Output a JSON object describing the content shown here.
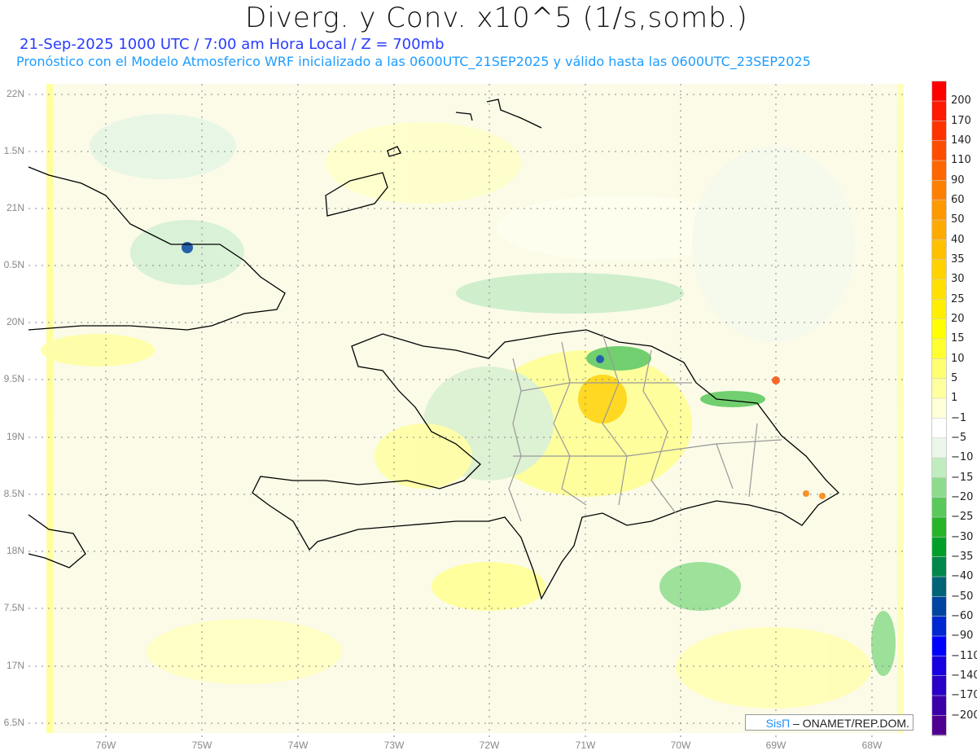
{
  "header": {
    "title": "Diverg. y Conv. x10^5 (1/s,somb.)",
    "valid_line": "21-Sep-2025  1000 UTC / 7:00 am Hora Local / Z = 700mb",
    "model_line": "Pronóstico con el Modelo Atmosferico WRF inicializado a las 0600UTC_21SEP2025 y válido hasta las  0600UTC_23SEP2025"
  },
  "map": {
    "lat_labels": [
      "22N",
      "1.5N",
      "21N",
      "0.5N",
      "20N",
      "9.5N",
      "19N",
      "8.5N",
      "18N",
      "7.5N",
      "17N",
      "6.5N"
    ],
    "lon_labels": [
      "76W",
      "75W",
      "74W",
      "73W",
      "72W",
      "71W",
      "70W",
      "69W",
      "68W"
    ]
  },
  "colorbar": {
    "labels": [
      "200",
      "170",
      "140",
      "110",
      "90",
      "60",
      "50",
      "40",
      "35",
      "30",
      "25",
      "20",
      "15",
      "10",
      "5",
      "1",
      "−1",
      "−5",
      "−10",
      "−15",
      "−20",
      "−25",
      "−30",
      "−35",
      "−40",
      "−50",
      "−60",
      "−90",
      "−110",
      "−140",
      "−170",
      "−200"
    ],
    "colors": [
      "#ff0000",
      "#ff1a00",
      "#ff3300",
      "#ff4d00",
      "#ff6600",
      "#ff8000",
      "#ff9900",
      "#ffaa00",
      "#ffc000",
      "#ffd200",
      "#ffe000",
      "#ffee00",
      "#ffff00",
      "#ffff30",
      "#ffff70",
      "#ffffa0",
      "#ffffd8",
      "#ffffff",
      "#eaf7ea",
      "#c0ecc0",
      "#8cdc8c",
      "#5ac85a",
      "#28b428",
      "#00a028",
      "#00874a",
      "#006478",
      "#0046a0",
      "#0028d2",
      "#0000ff",
      "#1800e0",
      "#2800c8",
      "#3c00aa",
      "#500090"
    ]
  },
  "credit": {
    "brand": "SisΠ",
    "text": " –  ONAMET/REP.DOM."
  }
}
